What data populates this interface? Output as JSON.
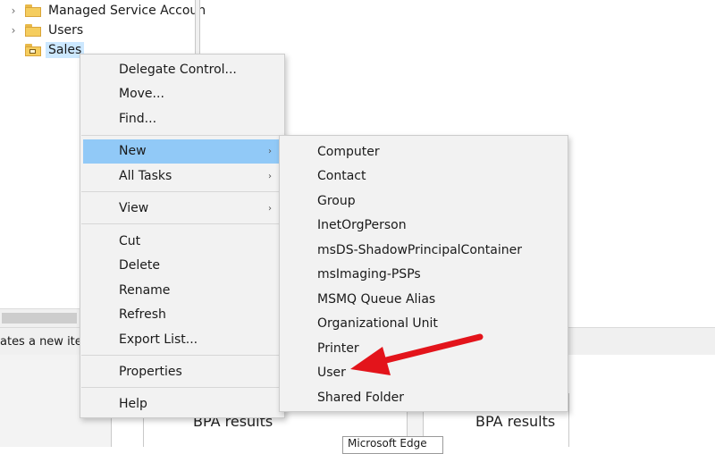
{
  "tree": {
    "items": [
      {
        "label": "Managed Service Accoun",
        "has_chevron": true
      },
      {
        "label": "Users",
        "has_chevron": true
      },
      {
        "label": "Sales",
        "has_chevron": false,
        "selected": true
      }
    ]
  },
  "status_bar": {
    "text": "ates a new iter"
  },
  "bpa": {
    "left_label": "BPA results",
    "right_label": "BPA results",
    "edge_label": "Microsoft Edge"
  },
  "context_menu": {
    "items": [
      {
        "label": "Delegate Control..."
      },
      {
        "label": "Move..."
      },
      {
        "label": "Find..."
      },
      {
        "label": "New",
        "submenu": true,
        "highlighted": true
      },
      {
        "label": "All Tasks",
        "submenu": true
      },
      {
        "label": "View",
        "submenu": true
      },
      {
        "label": "Cut"
      },
      {
        "label": "Delete"
      },
      {
        "label": "Rename"
      },
      {
        "label": "Refresh"
      },
      {
        "label": "Export List..."
      },
      {
        "label": "Properties"
      },
      {
        "label": "Help"
      }
    ]
  },
  "new_submenu": {
    "items": [
      {
        "label": "Computer"
      },
      {
        "label": "Contact"
      },
      {
        "label": "Group"
      },
      {
        "label": "InetOrgPerson"
      },
      {
        "label": "msDS-ShadowPrincipalContainer"
      },
      {
        "label": "msImaging-PSPs"
      },
      {
        "label": "MSMQ Queue Alias"
      },
      {
        "label": "Organizational Unit"
      },
      {
        "label": "Printer"
      },
      {
        "label": "User"
      },
      {
        "label": "Shared Folder"
      }
    ]
  },
  "colors": {
    "highlight": "#91c9f7",
    "selection": "#cce8ff",
    "annotation_arrow": "#e3141b"
  },
  "icons": {
    "submenu_arrow": "›",
    "tree_chevron": "›"
  }
}
